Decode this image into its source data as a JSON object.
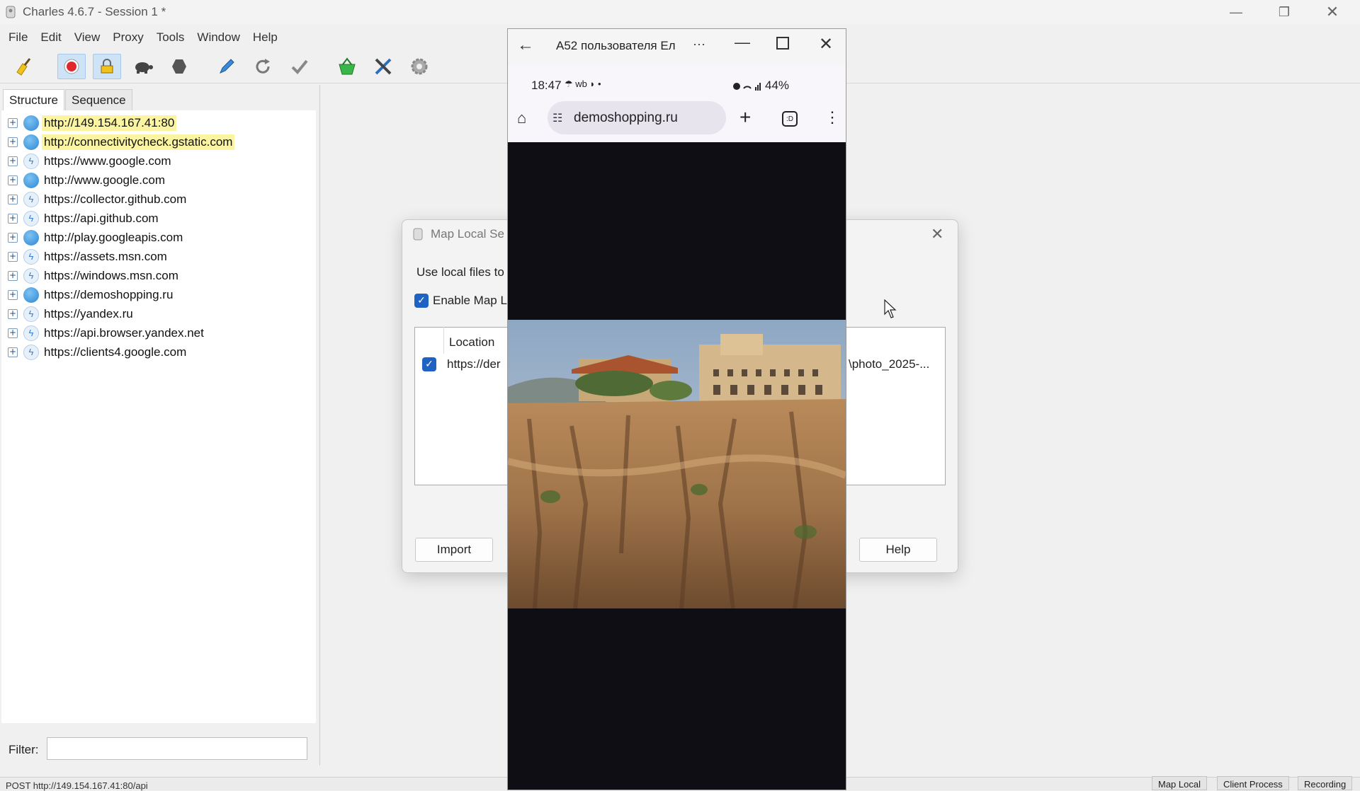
{
  "app": {
    "title": "Charles 4.6.7 - Session 1 *"
  },
  "menu": [
    "File",
    "Edit",
    "View",
    "Proxy",
    "Tools",
    "Window",
    "Help"
  ],
  "toolbar": [
    {
      "icon": "broom-icon",
      "active": false
    },
    {
      "icon": "record-icon",
      "active": true
    },
    {
      "icon": "ssl-proxying-icon",
      "active": true
    },
    {
      "icon": "throttle-turtle-icon",
      "active": false
    },
    {
      "icon": "breakpoints-hexagon-icon",
      "active": false
    },
    {
      "icon": "compose-pen-icon",
      "active": false
    },
    {
      "icon": "repeat-icon",
      "active": false
    },
    {
      "icon": "validate-check-icon",
      "active": false
    },
    {
      "icon": "basket-icon",
      "active": false
    },
    {
      "icon": "tools-icon",
      "active": false
    },
    {
      "icon": "settings-gear-icon",
      "active": false
    }
  ],
  "left": {
    "tabs": [
      "Structure",
      "Sequence"
    ],
    "hosts": [
      {
        "label": "http://149.154.167.41:80",
        "icon": "globe",
        "highlight": true
      },
      {
        "label": "http://connectivitycheck.gstatic.com",
        "icon": "globe",
        "highlight": true
      },
      {
        "label": "https://www.google.com",
        "icon": "bolt",
        "highlight": false
      },
      {
        "label": "http://www.google.com",
        "icon": "globe",
        "highlight": false
      },
      {
        "label": "https://collector.github.com",
        "icon": "bolt",
        "highlight": false
      },
      {
        "label": "https://api.github.com",
        "icon": "bolt",
        "highlight": false
      },
      {
        "label": "http://play.googleapis.com",
        "icon": "globe",
        "highlight": false
      },
      {
        "label": "https://assets.msn.com",
        "icon": "bolt",
        "highlight": false
      },
      {
        "label": "https://windows.msn.com",
        "icon": "bolt",
        "highlight": false
      },
      {
        "label": "https://demoshopping.ru",
        "icon": "globe",
        "highlight": false
      },
      {
        "label": "https://yandex.ru",
        "icon": "bolt",
        "highlight": false
      },
      {
        "label": "https://api.browser.yandex.net",
        "icon": "bolt",
        "highlight": false
      },
      {
        "label": "https://clients4.google.com",
        "icon": "bolt",
        "highlight": false
      }
    ],
    "filter_label": "Filter:",
    "filter_value": ""
  },
  "status": {
    "text": "POST http://149.154.167.41:80/api",
    "buttons": [
      "Map Local",
      "Client Process",
      "Recording"
    ]
  },
  "dialog": {
    "title": "Map Local Se",
    "description": "Use local files to",
    "enable_label": "Enable Map L",
    "enabled": true,
    "column_location": "Location",
    "row": {
      "checked": true,
      "location": "https://der",
      "local_path": "\\photo_2025-..."
    },
    "buttons": {
      "import": "Import",
      "help": "Help"
    }
  },
  "phone": {
    "window_title": "A52 пользователя Ел",
    "more": "···",
    "status_time": "18:47",
    "status_icons": "☂ wb ◗ •",
    "battery": "44%",
    "url": "demoshopping.ru",
    "tabs_count": ":D"
  },
  "colors": {
    "accent": "#1e63c4",
    "highlight": "#fbf5a2",
    "phone_bg": "#0f0e14",
    "record_red": "#e0262f"
  }
}
